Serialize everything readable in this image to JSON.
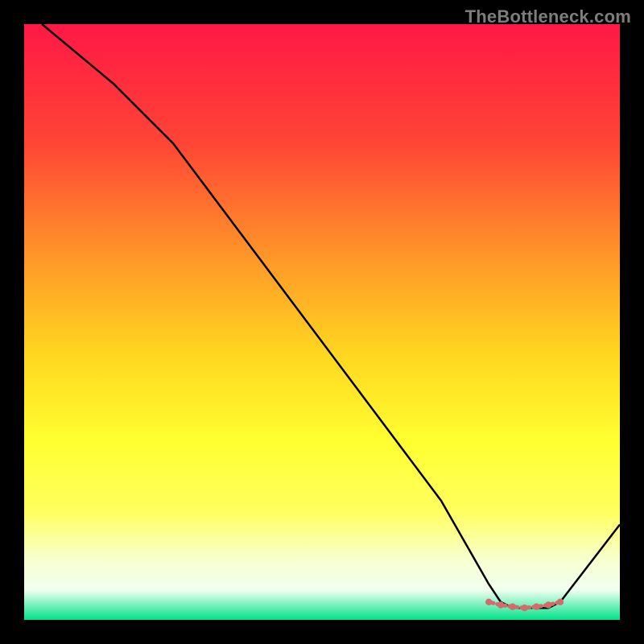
{
  "watermark": "TheBottleneck.com",
  "chart_data": {
    "type": "line",
    "title": "",
    "xlabel": "",
    "ylabel": "",
    "xlim": [
      0,
      100
    ],
    "ylim": [
      0,
      100
    ],
    "grid": false,
    "legend": false,
    "series": [
      {
        "name": "curve",
        "x": [
          3,
          15,
          25,
          40,
          55,
          70,
          78,
          80,
          82,
          84,
          86,
          88,
          90,
          100
        ],
        "values": [
          100,
          90,
          80,
          60,
          40,
          20,
          6,
          3,
          2,
          2,
          2,
          2,
          3,
          16
        ]
      }
    ],
    "markers": {
      "name": "highlighted-points",
      "color": "#d46a6a",
      "x": [
        78,
        80,
        82,
        84,
        86,
        88,
        90
      ],
      "values": [
        3,
        2.5,
        2.2,
        2.0,
        2.2,
        2.5,
        3
      ]
    },
    "gradient_stops": [
      {
        "offset": 0.0,
        "color": "#ff1846"
      },
      {
        "offset": 0.2,
        "color": "#ff4535"
      },
      {
        "offset": 0.4,
        "color": "#ff9a28"
      },
      {
        "offset": 0.55,
        "color": "#ffd520"
      },
      {
        "offset": 0.7,
        "color": "#ffff30"
      },
      {
        "offset": 0.82,
        "color": "#ffff60"
      },
      {
        "offset": 0.9,
        "color": "#f8ffd0"
      },
      {
        "offset": 0.95,
        "color": "#f0fff0"
      },
      {
        "offset": 1.0,
        "color": "#00e28a"
      }
    ]
  }
}
